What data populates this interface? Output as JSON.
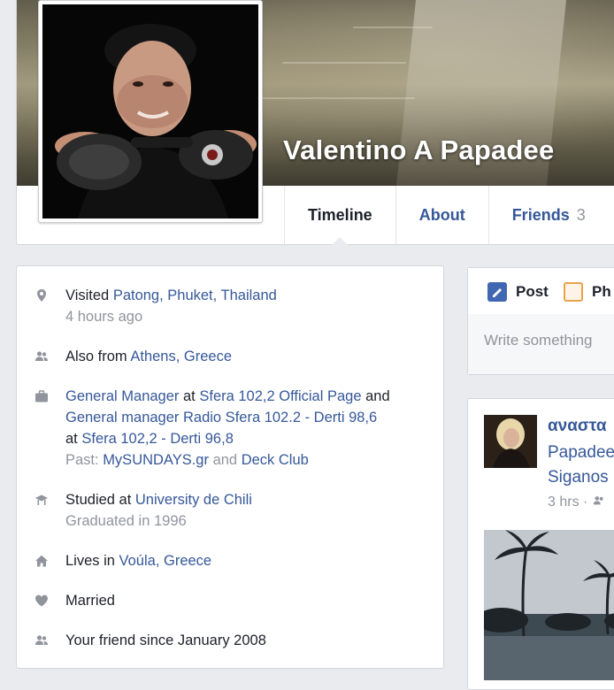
{
  "profile": {
    "name": "Valentino A Papadee"
  },
  "tabs": [
    {
      "label": "Timeline"
    },
    {
      "label": "About"
    },
    {
      "label": "Friends",
      "count": "3"
    }
  ],
  "intro": {
    "visited": {
      "prefix": "Visited ",
      "place": "Patong, Phuket, Thailand",
      "time": "4 hours ago"
    },
    "from": {
      "prefix": "Also from ",
      "place": "Athens, Greece"
    },
    "work": {
      "role1": "General Manager",
      "at1": " at ",
      "org1": "Sfera 102,2 Official Page",
      "and": " and ",
      "role2": "General manager Radio Sfera 102.2 - Derti 98,6",
      "at2": "at ",
      "org2": "Sfera 102,2 - Derti 96,8",
      "past_prefix": "Past: ",
      "past1": "MySUNDAYS.gr",
      "past_and": " and ",
      "past2": "Deck Club"
    },
    "education": {
      "prefix": "Studied at ",
      "school": "University de Chili",
      "graduated": "Graduated in 1996"
    },
    "lives": {
      "prefix": "Lives in ",
      "place": "Voúla, Greece"
    },
    "relationship": "Married",
    "friend_since": "Your friend since January 2008"
  },
  "composer": {
    "post_tab": "Post",
    "photo_tab": "Ph",
    "placeholder": "Write something"
  },
  "post": {
    "author": "αναστα",
    "line2": "Papadee",
    "line3": "Siganos",
    "time": "3 hrs ·"
  },
  "colors": {
    "link": "#365899",
    "muted": "#90949c",
    "background": "#e9ebee",
    "post_icon": "#4267b2",
    "photo_icon": "#e9a44b"
  }
}
